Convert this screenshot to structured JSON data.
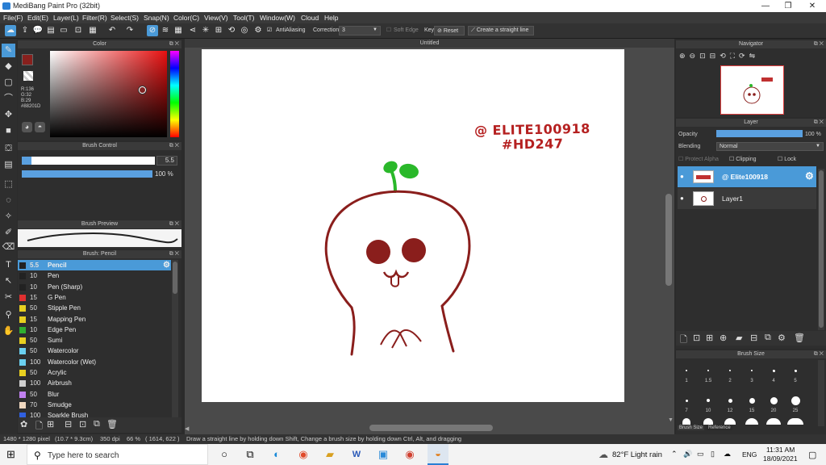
{
  "window": {
    "title": "MediBang Paint Pro (32bit)",
    "min": "—",
    "max": "❐",
    "close": "✕"
  },
  "menu": [
    "File(F)",
    "Edit(E)",
    "Layer(L)",
    "Filter(R)",
    "Select(S)",
    "Snap(N)",
    "Color(C)",
    "View(V)",
    "Tool(T)",
    "Window(W)",
    "Cloud",
    "Help"
  ],
  "toolbar": {
    "antialiasing": "AntiAliasing",
    "correction_label": "Correction",
    "correction_value": "3",
    "soft_edge": "Soft Edge",
    "key": "Key",
    "reset": "Reset",
    "straight_line": "Create a straight line"
  },
  "color_panel": {
    "title": "Color",
    "r": "R:136",
    "g": "G:32",
    "b": "B:29",
    "hex": "#88201D",
    "fg_color": "#88201D"
  },
  "brush_control": {
    "title": "Brush Control",
    "size": "5.5",
    "opacity": "100 %"
  },
  "brush_preview": {
    "title": "Brush Preview"
  },
  "brush_list": {
    "title": "Brush: Pencil",
    "items": [
      {
        "size": "5.5",
        "name": "Pencil",
        "color": "#222222"
      },
      {
        "size": "10",
        "name": "Pen",
        "color": "#222222"
      },
      {
        "size": "10",
        "name": "Pen (Sharp)",
        "color": "#222222"
      },
      {
        "size": "15",
        "name": "G Pen",
        "color": "#e03030"
      },
      {
        "size": "50",
        "name": "Stipple Pen",
        "color": "#e8d020"
      },
      {
        "size": "15",
        "name": "Mapping Pen",
        "color": "#e8d020"
      },
      {
        "size": "10",
        "name": "Edge Pen",
        "color": "#30b030"
      },
      {
        "size": "50",
        "name": "Sumi",
        "color": "#e8d020"
      },
      {
        "size": "50",
        "name": "Watercolor",
        "color": "#6ad0f0"
      },
      {
        "size": "100",
        "name": "Watercolor (Wet)",
        "color": "#6ad0f0"
      },
      {
        "size": "50",
        "name": "Acrylic",
        "color": "#e8d020"
      },
      {
        "size": "100",
        "name": "Airbrush",
        "color": "#d0d0d0"
      },
      {
        "size": "50",
        "name": "Blur",
        "color": "#c080f0"
      },
      {
        "size": "70",
        "name": "Smudge",
        "color": "#f0d8c0"
      },
      {
        "size": "100",
        "name": "Sparkle Brush",
        "color": "#3060e0"
      }
    ]
  },
  "canvas": {
    "title": "Untitled",
    "text_line1": "@ ELITE100918",
    "text_line2": "#HD247"
  },
  "navigator": {
    "title": "Navigator"
  },
  "layer_panel": {
    "title": "Layer",
    "opacity_label": "Opacity",
    "opacity_value": "100 %",
    "blending_label": "Blending",
    "blending_value": "Normal",
    "protect_alpha": "Protect Alpha",
    "clipping": "Clipping",
    "lock": "Lock",
    "layers": [
      {
        "name": "@ Elite100918",
        "selected": true
      },
      {
        "name": "Layer1",
        "selected": false
      }
    ]
  },
  "brush_size": {
    "title": "Brush Size",
    "row1": [
      "1",
      "1.5",
      "2",
      "3",
      "4",
      "5"
    ],
    "row2": [
      "7",
      "10",
      "12",
      "15",
      "20",
      "25"
    ],
    "tabs": [
      "Brush Size",
      "Reference"
    ]
  },
  "status": {
    "dimensions": "1480 * 1280 pixel",
    "physical": "(10.7 * 9.3cm)",
    "dpi": "350 dpi",
    "zoom": "66 %",
    "coords": "( 1614, 622 )",
    "hint": "Draw a straight line by holding down Shift, Change a brush size by holding down Ctrl, Alt, and dragging"
  },
  "taskbar": {
    "search_placeholder": "Type here to search",
    "weather": "82°F  Light rain",
    "lang": "ENG",
    "time": "11:31 AM",
    "date": "18/09/2021"
  }
}
